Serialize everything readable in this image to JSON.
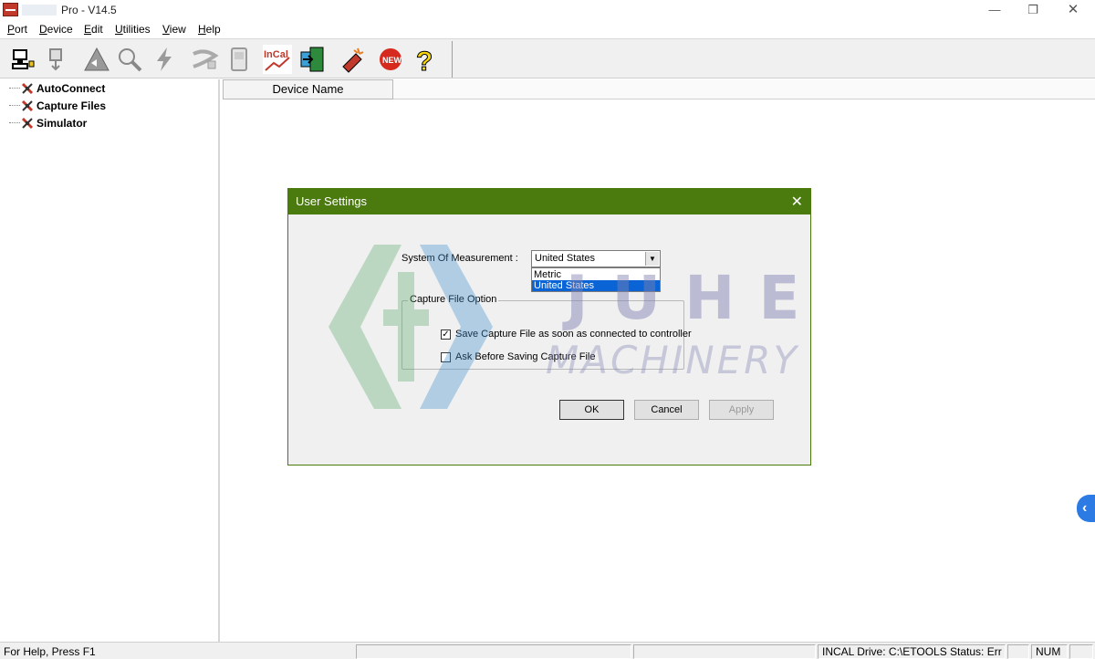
{
  "window": {
    "title": "Pro - V14.5",
    "controls": {
      "minimize": "—",
      "maximize": "❐",
      "close": "✕"
    }
  },
  "menu": [
    {
      "label": "Port",
      "accel": "P"
    },
    {
      "label": "Device",
      "accel": "D"
    },
    {
      "label": "Edit",
      "accel": "E"
    },
    {
      "label": "Utilities",
      "accel": "U"
    },
    {
      "label": "View",
      "accel": "V"
    },
    {
      "label": "Help",
      "accel": "H"
    }
  ],
  "toolbar": {
    "buttons": [
      {
        "icon": "connect-icon"
      },
      {
        "icon": "download-icon"
      },
      {
        "icon": "triangle-arrow-icon"
      },
      {
        "icon": "magnifier-icon"
      },
      {
        "icon": "lightning-icon"
      },
      {
        "icon": "cable-icon"
      },
      {
        "icon": "device-meter-icon"
      },
      {
        "icon": "incal-icon",
        "text": "InCal"
      },
      {
        "icon": "exit-door-icon"
      },
      {
        "icon": "sparkle-plug-icon"
      },
      {
        "icon": "new-badge-icon",
        "text": "NEW"
      },
      {
        "icon": "help-question-icon",
        "text": "?"
      }
    ]
  },
  "tree": {
    "items": [
      {
        "label": "AutoConnect"
      },
      {
        "label": "Capture Files"
      },
      {
        "label": "Simulator"
      }
    ]
  },
  "list": {
    "columns": [
      "Device Name"
    ]
  },
  "dialog": {
    "title": "User Settings",
    "close": "✕",
    "system_label": "System Of Measurement :",
    "system_value": "United States",
    "system_options": [
      "Metric",
      "United States"
    ],
    "selected_option_index": 1,
    "group_title": "Capture File Option",
    "checkboxes": [
      {
        "label": "Save Capture File as soon as connected to controller",
        "checked": true
      },
      {
        "label": "Ask Before Saving Capture File",
        "checked": false
      }
    ],
    "buttons": {
      "ok": "OK",
      "cancel": "Cancel",
      "apply": "Apply"
    }
  },
  "watermark": {
    "line1": "JUHE",
    "line2": "MACHINERY"
  },
  "side_tab": {
    "icon": "chevron-left-icon",
    "glyph": "‹"
  },
  "status": {
    "help": "For Help, Press F1",
    "panes": [
      "",
      "",
      "INCAL Drive: C:\\ETOOLS   Status: Err",
      "",
      "NUM",
      ""
    ]
  },
  "colors": {
    "dialog_title_bg": "#4b7b0e",
    "selection": "#0a64d6",
    "side_tab": "#2c7be5"
  }
}
